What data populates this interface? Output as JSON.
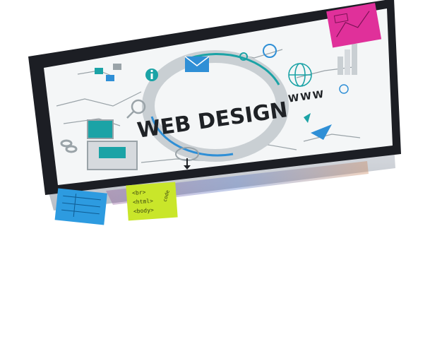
{
  "scene": {
    "title": "WEB DESIGN",
    "www": "WWW",
    "note_lines": [
      "<br>",
      "<html>",
      "<body>"
    ],
    "note_side": "code",
    "colors": {
      "bezel": "#1c1e24",
      "screen": "#f4f6f7",
      "teal": "#1ba3a6",
      "blue": "#2f8fd6",
      "grey": "#9aa3a8",
      "dark_text": "#1f2226",
      "pink_note": "#e0309a",
      "yellow_note": "#c9e62a",
      "blue_note": "#2d9be0"
    },
    "icons": [
      "info-icon",
      "envelope-icon",
      "globe-icon",
      "gear-icon",
      "cloud-download-icon",
      "link-icon",
      "monitor-icon",
      "magnifier-icon",
      "bar-chart-icon",
      "pointer-icon",
      "triangle-icon"
    ]
  }
}
